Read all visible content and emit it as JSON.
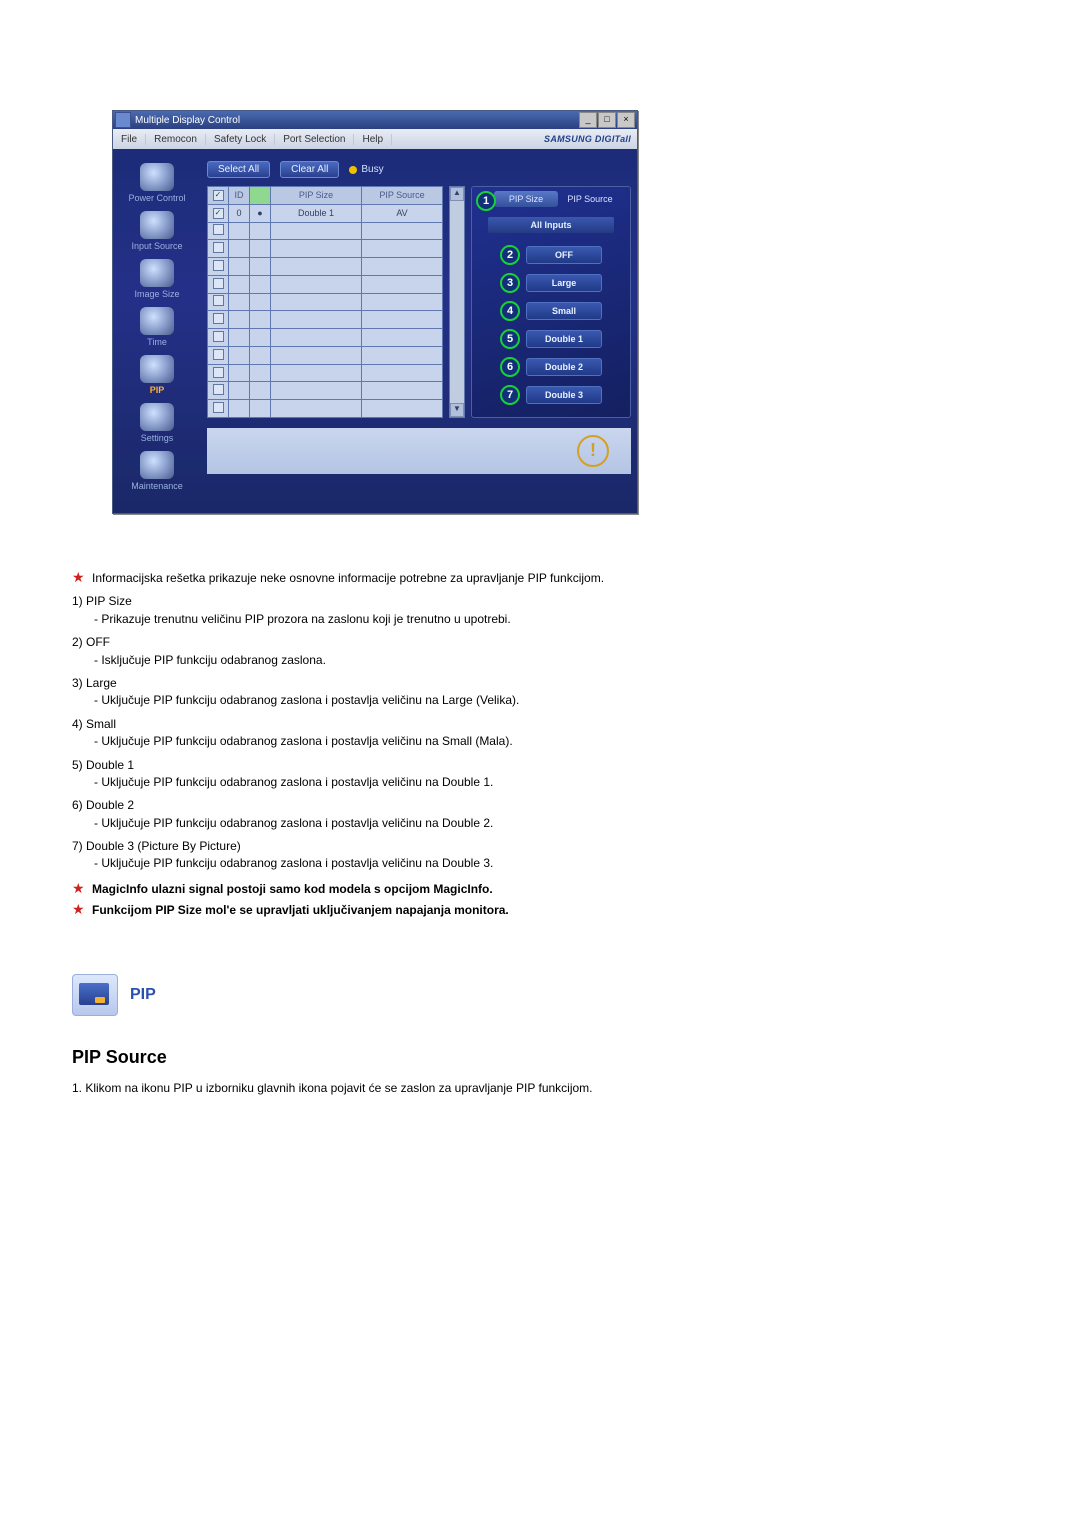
{
  "window": {
    "title": "Multiple Display Control",
    "btn_min": "_",
    "btn_max": "□",
    "btn_close": "×"
  },
  "menubar": {
    "file": "File",
    "remocon": "Remocon",
    "safety": "Safety Lock",
    "port": "Port Selection",
    "help": "Help",
    "brand": "SAMSUNG DIGITall"
  },
  "sidebar": {
    "items": [
      {
        "label": "Power Control"
      },
      {
        "label": "Input Source"
      },
      {
        "label": "Image Size"
      },
      {
        "label": "Time"
      },
      {
        "label": "PIP"
      },
      {
        "label": "Settings"
      },
      {
        "label": "Maintenance"
      }
    ]
  },
  "topbuttons": {
    "select_all": "Select All",
    "clear_all": "Clear All",
    "busy": "Busy"
  },
  "table": {
    "cols": {
      "chk": "✓",
      "id": "ID",
      "status": "",
      "pipsz": "PIP Size",
      "pipsrc": "PIP Source"
    },
    "row0": {
      "id": "0",
      "status": "●",
      "pipsz": "Double 1",
      "pipsrc": "AV"
    }
  },
  "right": {
    "tab_size": "PIP Size",
    "tab_source": "PIP Source",
    "all_inputs": "All Inputs",
    "items": [
      {
        "n": "2",
        "label": "OFF"
      },
      {
        "n": "3",
        "label": "Large"
      },
      {
        "n": "4",
        "label": "Small"
      },
      {
        "n": "5",
        "label": "Double 1"
      },
      {
        "n": "6",
        "label": "Double 2"
      },
      {
        "n": "7",
        "label": "Double 3"
      }
    ],
    "callout1": "1"
  },
  "doc": {
    "intro": "Informacijska rešetka prikazuje neke osnovne informacije potrebne za upravljanje PIP funkcijom.",
    "items": [
      {
        "hd": "1)  PIP Size",
        "sub": "- Prikazuje trenutnu veličinu PIP prozora na zaslonu koji je trenutno u upotrebi."
      },
      {
        "hd": "2)  OFF",
        "sub": "- Isključuje PIP funkciju odabranog zaslona."
      },
      {
        "hd": "3)  Large",
        "sub": "- Uključuje PIP funkciju odabranog zaslona i postavlja veličinu na Large (Velika)."
      },
      {
        "hd": "4)  Small",
        "sub": "- Uključuje PIP funkciju odabranog zaslona i postavlja veličinu na Small (Mala)."
      },
      {
        "hd": "5)  Double 1",
        "sub": "- Uključuje PIP funkciju odabranog zaslona i postavlja veličinu na Double 1."
      },
      {
        "hd": "6)  Double 2",
        "sub": "- Uključuje PIP funkciju odabranog zaslona i postavlja veličinu na Double 2."
      },
      {
        "hd": "7)  Double 3 (Picture By Picture)",
        "sub": "- Uključuje PIP funkciju odabranog zaslona i postavlja veličinu na Double 3."
      }
    ],
    "note1": "MagicInfo ulazni signal postoji samo kod modela s opcijom MagicInfo.",
    "note2": "Funkcijom PIP Size mol'e se upravljati uključivanjem napajanja monitora."
  },
  "pip": {
    "label": "PIP",
    "subhead": "PIP Source",
    "line": "1.  Klikom na ikonu PIP u izborniku glavnih ikona pojavit će se zaslon za upravljanje PIP funkcijom."
  }
}
